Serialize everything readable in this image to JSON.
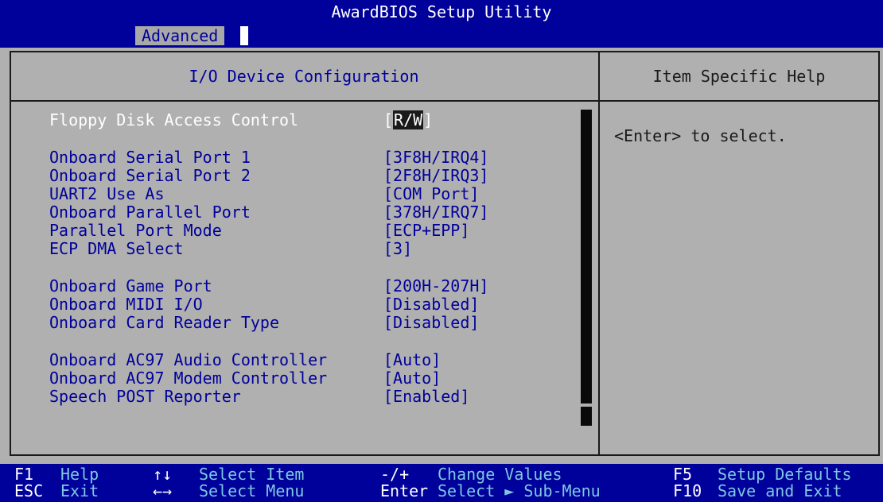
{
  "title": "AwardBIOS Setup Utility",
  "menu": {
    "active_tab": "Advanced"
  },
  "panel": {
    "title": "I/O Device Configuration",
    "help_title": "Item Specific Help",
    "help_text": "<Enter> to select."
  },
  "settings": [
    {
      "label": "Floppy Disk Access Control",
      "value_open": "[",
      "value": "R/W",
      "value_close": "]",
      "selected": true
    },
    {
      "label": "Onboard Serial Port 1",
      "value": "[3F8H/IRQ4]"
    },
    {
      "label": "Onboard Serial Port 2",
      "value": "[2F8H/IRQ3]"
    },
    {
      "label": "UART2 Use As",
      "value": "[COM Port]"
    },
    {
      "label": "Onboard Parallel Port",
      "value": "[378H/IRQ7]"
    },
    {
      "label": "Parallel Port Mode",
      "value": "[ECP+EPP]"
    },
    {
      "label": "ECP DMA Select",
      "value": "[3]"
    },
    {
      "label": "Onboard Game Port",
      "value": "[200H-207H]"
    },
    {
      "label": "Onboard MIDI I/O",
      "value": "[Disabled]"
    },
    {
      "label": "Onboard Card Reader Type",
      "value": "[Disabled]"
    },
    {
      "label": "Onboard AC97 Audio Controller",
      "value": "[Auto]"
    },
    {
      "label": "Onboard AC97 Modem Controller",
      "value": "[Auto]"
    },
    {
      "label": "Speech POST Reporter",
      "value": "[Enabled]"
    }
  ],
  "footer": [
    {
      "key": "F1",
      "desc": "Help"
    },
    {
      "key": "ESC",
      "desc": "Exit"
    },
    {
      "key": "↑↓",
      "desc": "Select Item"
    },
    {
      "key": "←→",
      "desc": "Select Menu"
    },
    {
      "key": "-/+",
      "desc": "Change Values"
    },
    {
      "key": "Enter",
      "desc": "Select ► Sub-Menu"
    },
    {
      "key": "F5",
      "desc": "Setup Defaults"
    },
    {
      "key": "F10",
      "desc": "Save and Exit"
    }
  ],
  "colors": {
    "bios_blue": "#00009b",
    "panel_gray": "#b0b0b0",
    "footer_desc": "#7ec8e0",
    "selected_text": "#ffffff"
  },
  "icons": {
    "scroll_down": "down-triangle-icon"
  }
}
